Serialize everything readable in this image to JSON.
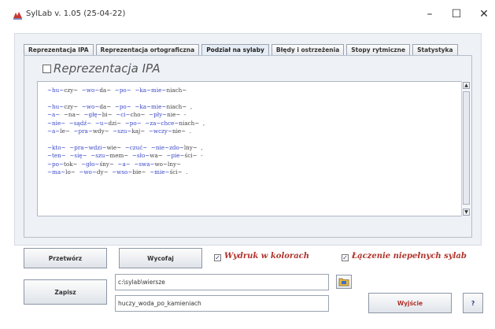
{
  "window": {
    "title": "SylLab v. 1.05 (25-04-22)",
    "min_label": "–",
    "max_label": "☐",
    "close_label": "✕"
  },
  "tabs": [
    {
      "label": "Reprezentacja IPA",
      "active": false
    },
    {
      "label": "Reprezentacja ortograficzna",
      "active": false
    },
    {
      "label": "Podział na sylaby",
      "active": true
    },
    {
      "label": "Błędy i ostrzeżenia",
      "active": false
    },
    {
      "label": "Stopy rytmiczne",
      "active": false
    },
    {
      "label": "Statystyka",
      "active": false
    }
  ],
  "panel": {
    "title": "Reprezentacja IPA",
    "checked": false
  },
  "syllabified_text": [
    [
      "~hu~",
      "czy~",
      "  ~wo~",
      "da~",
      "  ~po~",
      "  ~ka~",
      "mie~",
      "niach~"
    ],
    [],
    [
      "~hu~",
      "czy~",
      "  ~wo~",
      "da~",
      "  ~po~",
      "  ~ka~",
      "mie~",
      "niach~",
      "  ,"
    ],
    [
      "~a~",
      "  ~na~",
      "  ~głę~",
      "bi~",
      "  ~ci~",
      "cho~",
      "  ~pły~",
      "nie~",
      "  -"
    ],
    [
      "~nie~",
      "  ~sądź~",
      "  ~u~",
      "dzi~",
      "  ~po~",
      "  ~za~",
      "chce~",
      "niach~",
      "  ,"
    ],
    [
      "~a~",
      "le~",
      "  ~pra~",
      "wdy~",
      "  ~szu~",
      "kaj~",
      "  ~wczy~",
      "nie~",
      "  ."
    ],
    [],
    [
      "~kto~",
      "  ~pra~",
      "wdzi~",
      "wie~",
      "  ~czuć~",
      "  ~nie~",
      "zdo~",
      "lny~",
      "  ,"
    ],
    [
      "~ten~",
      "  ~się~",
      "  ~szu~",
      "mem~",
      "  ~sło~",
      "wa~",
      "  ~pie~",
      "ści~",
      "  -"
    ],
    [
      "~po~",
      "tok~",
      "  ~gło~",
      "śny~",
      "  ~a~",
      "  ~swa~",
      "wo~",
      "lny~"
    ],
    [
      "~ma~",
      "lo~",
      "  ~wo~",
      "dy~",
      "  ~wso~",
      "bie~",
      "  ~mie~",
      "ści~",
      "  ."
    ]
  ],
  "buttons": {
    "process": "Przetwórz",
    "undo": "Wycofaj",
    "save": "Zapisz",
    "exit": "Wyjście",
    "help": "?"
  },
  "options": {
    "print_colors": {
      "label": "Wydruk w kolorach",
      "checked": true
    },
    "join_incomplete": {
      "label": "Łączenie niepełnych sylab",
      "checked": true
    }
  },
  "fields": {
    "path": "c:\\sylab\\wiersze",
    "filename": "huczy_woda_po_kamieniach"
  },
  "colors": {
    "syllable_highlight": "#3b48c8",
    "option_label": "#b0332b",
    "panel_bg": "#eef1f6"
  },
  "icons": {
    "app": "app-logo-icon",
    "folder": "folder-open-icon",
    "scroll_up": "arrow-up-icon",
    "scroll_down": "arrow-down-icon"
  }
}
